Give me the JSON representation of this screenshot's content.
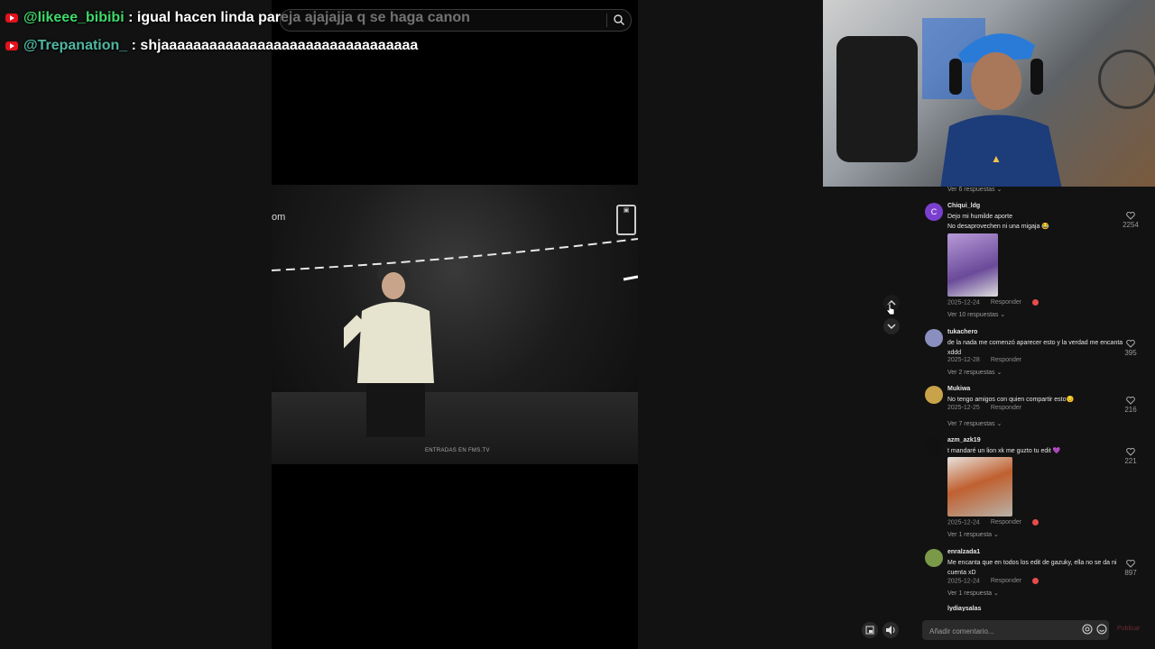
{
  "chat": {
    "messages": [
      {
        "user": "@likeee_bibibi",
        "text": ": igual hacen linda pareja ajajajja q se haga canon",
        "user_color": "#3ed96a"
      },
      {
        "user": "@Trepanation_",
        "text": ": shjaaaaaaaaaaaaaaaaaaaaaaaaaaaaaaaa",
        "user_color": "#4fb7a0"
      }
    ]
  },
  "video": {
    "watermark_left": "om",
    "watermark_bottom": "ENTRADAS EN FMS.TV"
  },
  "comments": {
    "top_replies": "Ver 6 respuestas",
    "items": [
      {
        "user": "Chiqui_ldg",
        "text": "Dejo mi humilde aporte\nNo desaprovechen ni una migaja 😂",
        "date": "2025-12-24",
        "reply": "Responder",
        "likes": "2254",
        "more": "Ver 10 respuestas",
        "avatar_letter": "C",
        "avatar_color": "#7b3fcf"
      },
      {
        "user": "tukachero",
        "text": "de la nada me comenzó aparecer esto y la verdad me encanta xddd",
        "date": "2025-12-28",
        "reply": "Responder",
        "likes": "395",
        "more": "Ver 2 respuestas",
        "avatar_color": "#8a8fbf"
      },
      {
        "user": "Mukiwa",
        "text": "No tengo amigos con quien compartir esto😔",
        "date": "2025-12-25",
        "reply": "Responder",
        "likes": "216",
        "more": "Ver 7 respuestas",
        "avatar_color": "#c9a34a"
      },
      {
        "user": "azm_azk19",
        "text": "t mandaré un lion xk me guzto tu edit 💜",
        "date": "2025-12-24",
        "reply": "Responder",
        "likes": "221",
        "more": "Ver 1 respuesta",
        "avatar_color": "#111111"
      },
      {
        "user": "enralzada1",
        "text": "Me encanta que en todos los edit de gazuky, ella no se da ni cuenta xD",
        "date": "2025-12-24",
        "reply": "Responder",
        "likes": "897",
        "more": "Ver 1 respuesta",
        "avatar_color": "#7a9a4a"
      }
    ],
    "partial_user": "lydiaysalas"
  },
  "composer": {
    "placeholder": "Añadir comentario...",
    "publish_label": "Publicar"
  },
  "colors": {
    "accent": "#fe2c55",
    "background": "#121212"
  }
}
